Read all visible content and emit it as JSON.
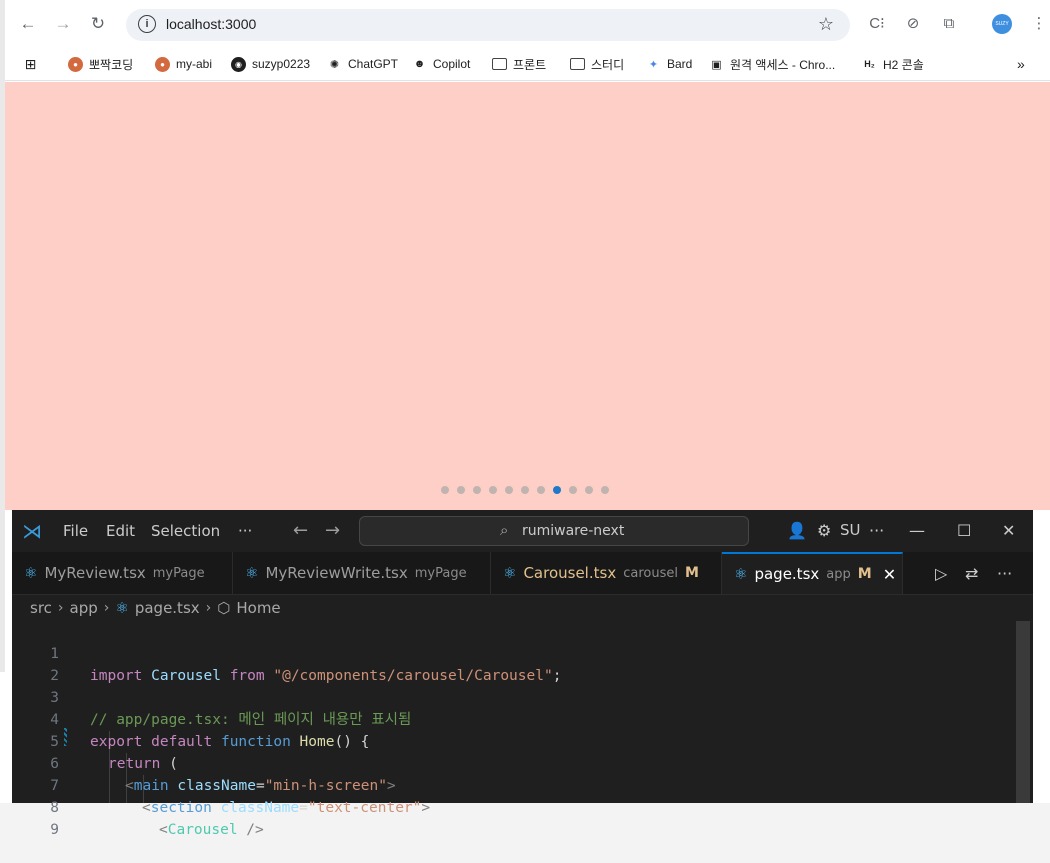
{
  "browser": {
    "url": "localhost:3000",
    "profile_label": "SUZY",
    "bookmarks": [
      {
        "label": "뽀짝코딩",
        "icon": "brown-circle-icon"
      },
      {
        "label": "my-abi",
        "icon": "brown-circle-icon"
      },
      {
        "label": "suzyp0223",
        "icon": "github-icon"
      },
      {
        "label": "ChatGPT",
        "icon": "chatgpt-icon"
      },
      {
        "label": "Copilot",
        "icon": "copilot-icon"
      },
      {
        "label": "프론트",
        "icon": "folder-icon"
      },
      {
        "label": "스터디",
        "icon": "folder-icon"
      },
      {
        "label": "Bard",
        "icon": "bard-icon"
      },
      {
        "label": "원격 액세스 - Chro...",
        "icon": "remote-icon"
      },
      {
        "label": "H2 콘솔",
        "icon": "h2-icon"
      }
    ]
  },
  "page": {
    "background": "#fdcfc6",
    "carousel": {
      "total_slides": 11,
      "active_index": 7
    }
  },
  "vscode": {
    "menu": {
      "file": "File",
      "edit": "Edit",
      "selection": "Selection",
      "more": "···"
    },
    "search": "rumiware-next",
    "account": "SU",
    "more": "···",
    "tabs": [
      {
        "name": "MyReview.tsx",
        "desc": "myPage",
        "modified": "",
        "active": false
      },
      {
        "name": "MyReviewWrite.tsx",
        "desc": "myPage",
        "modified": "",
        "active": false
      },
      {
        "name": "Carousel.tsx",
        "desc": "carousel",
        "modified": "M",
        "active": false
      },
      {
        "name": "page.tsx",
        "desc": "app",
        "modified": "M",
        "active": true
      }
    ],
    "breadcrumb": {
      "p1": "src",
      "p2": "app",
      "p3": "page.tsx",
      "p4": "Home"
    },
    "line_numbers": [
      "1",
      "2",
      "3",
      "4",
      "5",
      "6",
      "7",
      "8",
      "9"
    ],
    "code": {
      "l1_import": "import",
      "l1_id": "Carousel",
      "l1_from": "from",
      "l1_str": "\"@/components/carousel/Carousel\"",
      "l1_semi": ";",
      "l3_comment": "// app/page.tsx: 메인 페이지 내용만 표시됨",
      "l4_export": "export",
      "l4_default": "default",
      "l4_function": "function",
      "l4_name": "Home",
      "l4_rest": "() {",
      "l5_return": "return",
      "l5_paren": " (",
      "l6_open": "<",
      "l6_tag": "main",
      "l6_attr": "className",
      "l6_eq": "=",
      "l6_val": "\"min-h-screen\"",
      "l6_close": ">",
      "l7_open": "<",
      "l7_tag": "section",
      "l7_attr": "className",
      "l7_eq": "=",
      "l7_val": "\"text-center\"",
      "l7_close": ">",
      "l8_open": "<",
      "l8_tag": "Carousel",
      "l8_close": " />"
    }
  }
}
